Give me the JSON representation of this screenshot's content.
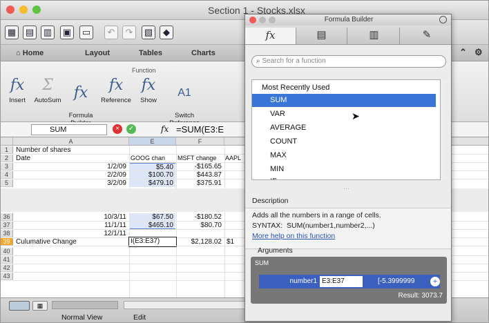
{
  "window": {
    "title": "Section 1 - Stocks.xlsx",
    "traffic_colors": {
      "close": "#ee5c54",
      "min": "#f5bd30",
      "max": "#5dc441"
    }
  },
  "toolbar": {
    "icons": [
      "new-file-icon",
      "template-icon",
      "open-icon",
      "save-icon",
      "print-icon",
      "undo-icon",
      "redo-icon",
      "paste-icon",
      "format-icon"
    ]
  },
  "ribbon": {
    "tabs": [
      "Home",
      "Layout",
      "Tables",
      "Charts"
    ],
    "group_label": "Function",
    "buttons": [
      {
        "label": "Insert",
        "icon": "fx"
      },
      {
        "label": "AutoSum",
        "icon": "Σ"
      },
      {
        "label": "Formula\nBuilder",
        "icon": "fx"
      },
      {
        "label": "Reference",
        "icon": "fx"
      },
      {
        "label": "Show",
        "icon": "fx"
      },
      {
        "label": "Switch\nReference",
        "icon": "A1"
      }
    ]
  },
  "formula_bar": {
    "name_box": "SUM",
    "fx": "fx",
    "formula": "=SUM(E3:E"
  },
  "sheet": {
    "columns": [
      "A",
      "E",
      "F"
    ],
    "rows": [
      {
        "num": "1",
        "a": "Number of shares",
        "e": "",
        "f": "",
        "g": ""
      },
      {
        "num": "2",
        "a": "Date",
        "e": "GOOG chan",
        "f": "MSFT change",
        "g": "AAPL"
      },
      {
        "num": "3",
        "a": "1/2/09",
        "e": "$5.40",
        "f": "-$165.65",
        "g": ""
      },
      {
        "num": "4",
        "a": "2/2/09",
        "e": "$100.70",
        "f": "$443.87",
        "g": ""
      },
      {
        "num": "5",
        "a": "3/2/09",
        "e": "$479.10",
        "f": "$375.91",
        "g": ""
      },
      {
        "num": "36",
        "a": "10/3/11",
        "e": "$67.50",
        "f": "-$180.52",
        "g": ""
      },
      {
        "num": "37",
        "a": "11/1/11",
        "e": "$465.10",
        "f": "$80.70",
        "g": ""
      },
      {
        "num": "38",
        "a": "12/1/11",
        "e": "",
        "f": "",
        "g": ""
      },
      {
        "num": "39",
        "a": "Culumative  Change",
        "e": "I(E3:E37)",
        "f": "$2,128.02",
        "g": "$1"
      },
      {
        "num": "40",
        "a": "",
        "e": "",
        "f": "",
        "g": ""
      },
      {
        "num": "41",
        "a": "",
        "e": "",
        "f": "",
        "g": ""
      },
      {
        "num": "42",
        "a": "",
        "e": "",
        "f": "",
        "g": ""
      },
      {
        "num": "43",
        "a": "",
        "e": "",
        "f": "",
        "g": ""
      }
    ]
  },
  "status_bar": {
    "view": "Normal View",
    "mode": "Edit"
  },
  "formula_builder": {
    "title": "Formula Builder",
    "tabs": [
      "fx",
      "insert-icon",
      "library-icon",
      "tools-icon"
    ],
    "search_placeholder": "Search for a function",
    "list_header": "Most Recently Used",
    "functions": [
      "SUM",
      "VAR",
      "AVERAGE",
      "COUNT",
      "MAX",
      "MIN",
      "IF"
    ],
    "selected": "SUM",
    "description_title": "Description",
    "description": "Adds all the numbers in a range of cells.",
    "syntax_label": "SYNTAX:",
    "syntax": "SUM(number1,number2,...)",
    "help_link": "More help on this function",
    "arguments_title": "Arguments",
    "args_header": "SUM",
    "arg_name": "number1",
    "arg_value": "E3:E37",
    "arg_result": "[-5.3999999",
    "result": "Result: 3073.7"
  }
}
